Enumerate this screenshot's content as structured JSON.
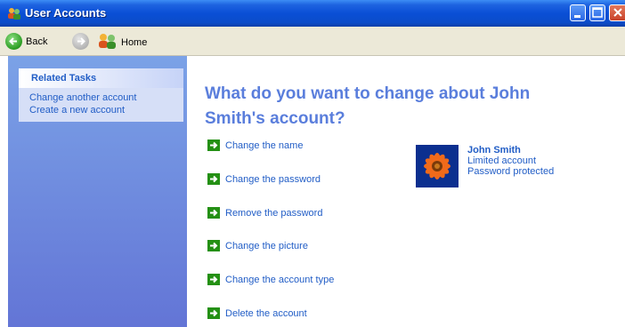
{
  "window": {
    "title": "User Accounts"
  },
  "toolbar": {
    "back_label": "Back",
    "home_label": "Home"
  },
  "related_tasks": {
    "header": "Related Tasks",
    "items": [
      "Change another account",
      "Create a new account"
    ]
  },
  "main": {
    "heading": "What do you want to change about John Smith's account?",
    "actions": [
      "Change the name",
      "Change the password",
      "Remove the password",
      "Change the picture",
      "Change the account type",
      "Delete the account"
    ]
  },
  "user": {
    "name": "John Smith",
    "type": "Limited account",
    "status": "Password protected",
    "picture_icon": "flower-picture"
  },
  "colors": {
    "titlebar": "#0a4fd6",
    "taskpane": "#7ba2e7",
    "link": "#215dc6",
    "heading": "#5a7edc",
    "arrow": "#249014"
  }
}
